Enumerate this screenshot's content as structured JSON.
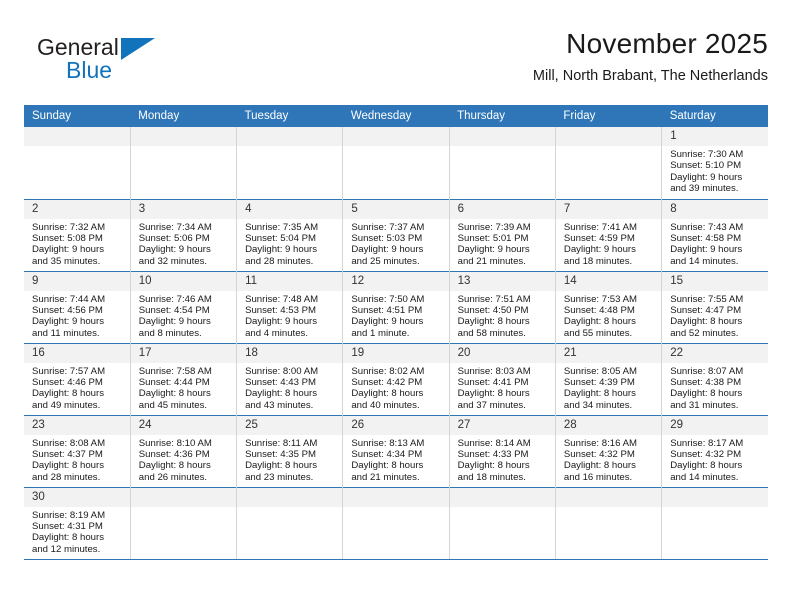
{
  "brand": {
    "name_part1": "General",
    "name_part2": "Blue",
    "flag_icon": "blue-triangle-flag",
    "color_black": "#231f20",
    "color_blue": "#1273bd"
  },
  "header": {
    "title": "November 2025",
    "subtitle": "Mill, North Brabant, The Netherlands",
    "accent_color": "#2e76b8"
  },
  "weekdays": [
    "Sunday",
    "Monday",
    "Tuesday",
    "Wednesday",
    "Thursday",
    "Friday",
    "Saturday"
  ],
  "labels": {
    "sunrise": "Sunrise:",
    "sunset": "Sunset:",
    "daylight": "Daylight:"
  },
  "weeks": [
    [
      {
        "day": "",
        "l1": "",
        "l2": "",
        "l3": "",
        "l4": ""
      },
      {
        "day": "",
        "l1": "",
        "l2": "",
        "l3": "",
        "l4": ""
      },
      {
        "day": "",
        "l1": "",
        "l2": "",
        "l3": "",
        "l4": ""
      },
      {
        "day": "",
        "l1": "",
        "l2": "",
        "l3": "",
        "l4": ""
      },
      {
        "day": "",
        "l1": "",
        "l2": "",
        "l3": "",
        "l4": ""
      },
      {
        "day": "",
        "l1": "",
        "l2": "",
        "l3": "",
        "l4": ""
      },
      {
        "day": "1",
        "l1": "Sunrise: 7:30 AM",
        "l2": "Sunset: 5:10 PM",
        "l3": "Daylight: 9 hours",
        "l4": "and 39 minutes."
      }
    ],
    [
      {
        "day": "2",
        "l1": "Sunrise: 7:32 AM",
        "l2": "Sunset: 5:08 PM",
        "l3": "Daylight: 9 hours",
        "l4": "and 35 minutes."
      },
      {
        "day": "3",
        "l1": "Sunrise: 7:34 AM",
        "l2": "Sunset: 5:06 PM",
        "l3": "Daylight: 9 hours",
        "l4": "and 32 minutes."
      },
      {
        "day": "4",
        "l1": "Sunrise: 7:35 AM",
        "l2": "Sunset: 5:04 PM",
        "l3": "Daylight: 9 hours",
        "l4": "and 28 minutes."
      },
      {
        "day": "5",
        "l1": "Sunrise: 7:37 AM",
        "l2": "Sunset: 5:03 PM",
        "l3": "Daylight: 9 hours",
        "l4": "and 25 minutes."
      },
      {
        "day": "6",
        "l1": "Sunrise: 7:39 AM",
        "l2": "Sunset: 5:01 PM",
        "l3": "Daylight: 9 hours",
        "l4": "and 21 minutes."
      },
      {
        "day": "7",
        "l1": "Sunrise: 7:41 AM",
        "l2": "Sunset: 4:59 PM",
        "l3": "Daylight: 9 hours",
        "l4": "and 18 minutes."
      },
      {
        "day": "8",
        "l1": "Sunrise: 7:43 AM",
        "l2": "Sunset: 4:58 PM",
        "l3": "Daylight: 9 hours",
        "l4": "and 14 minutes."
      }
    ],
    [
      {
        "day": "9",
        "l1": "Sunrise: 7:44 AM",
        "l2": "Sunset: 4:56 PM",
        "l3": "Daylight: 9 hours",
        "l4": "and 11 minutes."
      },
      {
        "day": "10",
        "l1": "Sunrise: 7:46 AM",
        "l2": "Sunset: 4:54 PM",
        "l3": "Daylight: 9 hours",
        "l4": "and 8 minutes."
      },
      {
        "day": "11",
        "l1": "Sunrise: 7:48 AM",
        "l2": "Sunset: 4:53 PM",
        "l3": "Daylight: 9 hours",
        "l4": "and 4 minutes."
      },
      {
        "day": "12",
        "l1": "Sunrise: 7:50 AM",
        "l2": "Sunset: 4:51 PM",
        "l3": "Daylight: 9 hours",
        "l4": "and 1 minute."
      },
      {
        "day": "13",
        "l1": "Sunrise: 7:51 AM",
        "l2": "Sunset: 4:50 PM",
        "l3": "Daylight: 8 hours",
        "l4": "and 58 minutes."
      },
      {
        "day": "14",
        "l1": "Sunrise: 7:53 AM",
        "l2": "Sunset: 4:48 PM",
        "l3": "Daylight: 8 hours",
        "l4": "and 55 minutes."
      },
      {
        "day": "15",
        "l1": "Sunrise: 7:55 AM",
        "l2": "Sunset: 4:47 PM",
        "l3": "Daylight: 8 hours",
        "l4": "and 52 minutes."
      }
    ],
    [
      {
        "day": "16",
        "l1": "Sunrise: 7:57 AM",
        "l2": "Sunset: 4:46 PM",
        "l3": "Daylight: 8 hours",
        "l4": "and 49 minutes."
      },
      {
        "day": "17",
        "l1": "Sunrise: 7:58 AM",
        "l2": "Sunset: 4:44 PM",
        "l3": "Daylight: 8 hours",
        "l4": "and 45 minutes."
      },
      {
        "day": "18",
        "l1": "Sunrise: 8:00 AM",
        "l2": "Sunset: 4:43 PM",
        "l3": "Daylight: 8 hours",
        "l4": "and 43 minutes."
      },
      {
        "day": "19",
        "l1": "Sunrise: 8:02 AM",
        "l2": "Sunset: 4:42 PM",
        "l3": "Daylight: 8 hours",
        "l4": "and 40 minutes."
      },
      {
        "day": "20",
        "l1": "Sunrise: 8:03 AM",
        "l2": "Sunset: 4:41 PM",
        "l3": "Daylight: 8 hours",
        "l4": "and 37 minutes."
      },
      {
        "day": "21",
        "l1": "Sunrise: 8:05 AM",
        "l2": "Sunset: 4:39 PM",
        "l3": "Daylight: 8 hours",
        "l4": "and 34 minutes."
      },
      {
        "day": "22",
        "l1": "Sunrise: 8:07 AM",
        "l2": "Sunset: 4:38 PM",
        "l3": "Daylight: 8 hours",
        "l4": "and 31 minutes."
      }
    ],
    [
      {
        "day": "23",
        "l1": "Sunrise: 8:08 AM",
        "l2": "Sunset: 4:37 PM",
        "l3": "Daylight: 8 hours",
        "l4": "and 28 minutes."
      },
      {
        "day": "24",
        "l1": "Sunrise: 8:10 AM",
        "l2": "Sunset: 4:36 PM",
        "l3": "Daylight: 8 hours",
        "l4": "and 26 minutes."
      },
      {
        "day": "25",
        "l1": "Sunrise: 8:11 AM",
        "l2": "Sunset: 4:35 PM",
        "l3": "Daylight: 8 hours",
        "l4": "and 23 minutes."
      },
      {
        "day": "26",
        "l1": "Sunrise: 8:13 AM",
        "l2": "Sunset: 4:34 PM",
        "l3": "Daylight: 8 hours",
        "l4": "and 21 minutes."
      },
      {
        "day": "27",
        "l1": "Sunrise: 8:14 AM",
        "l2": "Sunset: 4:33 PM",
        "l3": "Daylight: 8 hours",
        "l4": "and 18 minutes."
      },
      {
        "day": "28",
        "l1": "Sunrise: 8:16 AM",
        "l2": "Sunset: 4:32 PM",
        "l3": "Daylight: 8 hours",
        "l4": "and 16 minutes."
      },
      {
        "day": "29",
        "l1": "Sunrise: 8:17 AM",
        "l2": "Sunset: 4:32 PM",
        "l3": "Daylight: 8 hours",
        "l4": "and 14 minutes."
      }
    ],
    [
      {
        "day": "30",
        "l1": "Sunrise: 8:19 AM",
        "l2": "Sunset: 4:31 PM",
        "l3": "Daylight: 8 hours",
        "l4": "and 12 minutes."
      },
      {
        "day": "",
        "l1": "",
        "l2": "",
        "l3": "",
        "l4": ""
      },
      {
        "day": "",
        "l1": "",
        "l2": "",
        "l3": "",
        "l4": ""
      },
      {
        "day": "",
        "l1": "",
        "l2": "",
        "l3": "",
        "l4": ""
      },
      {
        "day": "",
        "l1": "",
        "l2": "",
        "l3": "",
        "l4": ""
      },
      {
        "day": "",
        "l1": "",
        "l2": "",
        "l3": "",
        "l4": ""
      },
      {
        "day": "",
        "l1": "",
        "l2": "",
        "l3": "",
        "l4": ""
      }
    ]
  ]
}
